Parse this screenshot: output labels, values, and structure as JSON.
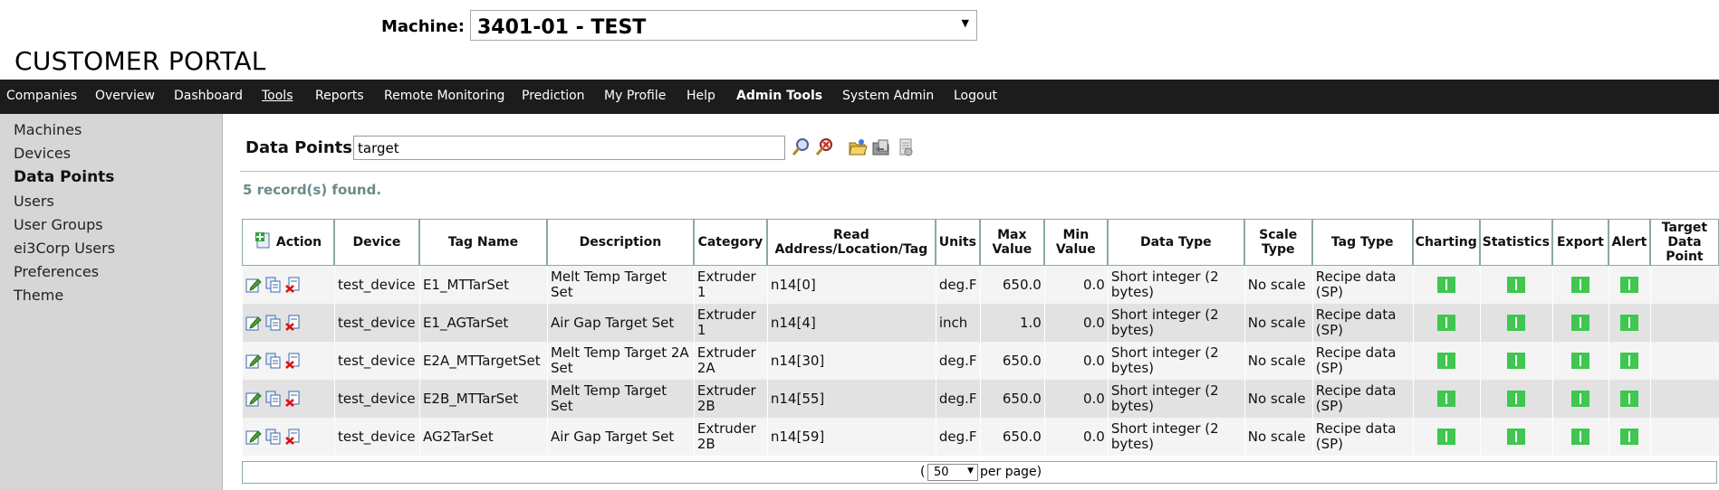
{
  "header": {
    "machine_label": "Machine:",
    "machine_value": "3401-01 - TEST",
    "portal_title": "CUSTOMER PORTAL"
  },
  "nav": {
    "items": [
      {
        "label": "Companies"
      },
      {
        "label": "Overview"
      },
      {
        "label": "Dashboard"
      },
      {
        "label": "Tools",
        "active": true
      },
      {
        "label": "Reports"
      },
      {
        "label": "Remote Monitoring"
      },
      {
        "label": "Prediction"
      },
      {
        "label": "My Profile"
      },
      {
        "label": "Help"
      },
      {
        "label": "Admin Tools",
        "bold": true
      },
      {
        "label": "System Admin"
      },
      {
        "label": "Logout"
      }
    ]
  },
  "sidebar": {
    "items": [
      {
        "label": "Machines"
      },
      {
        "label": "Devices"
      },
      {
        "label": "Data Points",
        "current": true
      },
      {
        "label": "Users"
      },
      {
        "label": "User Groups"
      },
      {
        "label": "ei3Corp Users"
      },
      {
        "label": "Preferences"
      },
      {
        "label": "Theme"
      }
    ]
  },
  "content": {
    "title": "Data Points",
    "search_value": "target",
    "records_found": "5 record(s) found."
  },
  "icons": {
    "search": "search-icon",
    "clear_search": "clear-search-icon",
    "open_folder": "open-folder-icon",
    "import": "import-icon",
    "export_doc": "export-document-icon",
    "add": "add-icon",
    "edit": "edit-icon",
    "copy": "copy-icon",
    "delete": "delete-icon"
  },
  "colors": {
    "nav_bg": "#1c1c1c",
    "sidebar_bg": "#d6d6d6",
    "status_green": "#3fc74f",
    "records_text": "#6c8a8a"
  },
  "table": {
    "headers": {
      "action": "Action",
      "device": "Device",
      "tag_name": "Tag Name",
      "description": "Description",
      "category": "Category",
      "read_address": "Read Address/Location/Tag",
      "units": "Units",
      "max_value": "Max Value",
      "min_value": "Min Value",
      "data_type": "Data Type",
      "scale_type": "Scale Type",
      "tag_type": "Tag Type",
      "charting": "Charting",
      "statistics": "Statistics",
      "export": "Export",
      "alert": "Alert",
      "target_data_point": "Target Data Point"
    },
    "rows": [
      {
        "device": "test_device",
        "tag_name": "E1_MTTarSet",
        "description": "Melt Temp Target Set",
        "category": "Extruder 1",
        "read_address": "n14[0]",
        "units": "deg.F",
        "max_value": "650.0",
        "min_value": "0.0",
        "data_type": "Short integer (2 bytes)",
        "scale_type": "No scale",
        "tag_type": "Recipe data (SP)",
        "target_data_point": ""
      },
      {
        "device": "test_device",
        "tag_name": "E1_AGTarSet",
        "description": "Air Gap Target Set",
        "category": "Extruder 1",
        "read_address": "n14[4]",
        "units": "inch",
        "max_value": "1.0",
        "min_value": "0.0",
        "data_type": "Short integer (2 bytes)",
        "scale_type": "No scale",
        "tag_type": "Recipe data (SP)",
        "target_data_point": ""
      },
      {
        "device": "test_device",
        "tag_name": "E2A_MTTargetSet",
        "description": "Melt Temp Target 2A Set",
        "category": "Extruder 2A",
        "read_address": "n14[30]",
        "units": "deg.F",
        "max_value": "650.0",
        "min_value": "0.0",
        "data_type": "Short integer (2 bytes)",
        "scale_type": "No scale",
        "tag_type": "Recipe data (SP)",
        "target_data_point": ""
      },
      {
        "device": "test_device",
        "tag_name": "E2B_MTTarSet",
        "description": "Melt Temp Target Set",
        "category": "Extruder 2B",
        "read_address": "n14[55]",
        "units": "deg.F",
        "max_value": "650.0",
        "min_value": "0.0",
        "data_type": "Short integer (2 bytes)",
        "scale_type": "No scale",
        "tag_type": "Recipe data (SP)",
        "target_data_point": ""
      },
      {
        "device": "test_device",
        "tag_name": "AG2TarSet",
        "description": "Air Gap Target Set",
        "category": "Extruder 2B",
        "read_address": "n14[59]",
        "units": "deg.F",
        "max_value": "650.0",
        "min_value": "0.0",
        "data_type": "Short integer (2 bytes)",
        "scale_type": "No scale",
        "tag_type": "Recipe data (SP)",
        "target_data_point": ""
      }
    ]
  },
  "pager": {
    "open_paren": "(",
    "per_page_value": "50",
    "per_page_text": "per page)"
  }
}
